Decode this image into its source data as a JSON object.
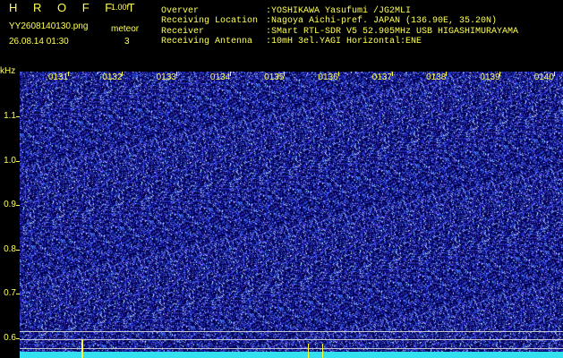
{
  "header": {
    "logo": "H R O F F T",
    "version": "1.00f",
    "filename": "YY2608140130.png",
    "datetime": "26.08.14 01:30",
    "meteor_label": "meteor",
    "meteor_count": "3",
    "info": [
      {
        "label": "Overver",
        "value": ":YOSHIKAWA Yasufumi /JG2MLI"
      },
      {
        "label": "Receiving Location",
        "value": ":Nagoya Aichi-pref. JAPAN (136.90E, 35.20N)"
      },
      {
        "label": "Receiver",
        "value": ":SMart RTL-SDR V5 52.905MHz USB HIGASHIMURAYAMA"
      },
      {
        "label": "Receiving Antenna",
        "value": ":10mH 3el.YAGI Horizontal:ENE"
      }
    ]
  },
  "chart_data": {
    "type": "heatmap",
    "ylabel": "kHz",
    "yticks": [
      "1.1",
      "1.0",
      "0.9",
      "0.8",
      "0.7",
      "0.6"
    ],
    "xticks": [
      "0131",
      "0132",
      "0133",
      "0134",
      "0135",
      "0136",
      "0137",
      "0138",
      "0139",
      "0140"
    ],
    "colors": {
      "background": "#000060",
      "noise": "#3040ff",
      "text": "#ffff55",
      "baseline": "#33e0f0"
    }
  }
}
